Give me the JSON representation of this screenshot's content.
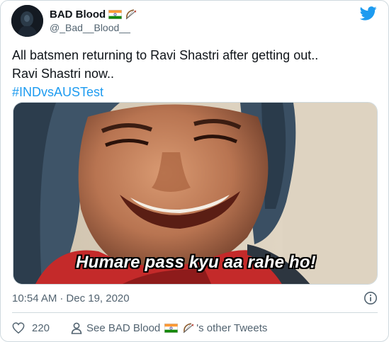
{
  "tweet": {
    "author": {
      "display_name": "BAD Blood",
      "handle": "@_Bad__Blood__",
      "name_emojis": [
        "india-flag-icon",
        "bow-and-arrow-icon"
      ]
    },
    "text_line1": "All batsmen returning to Ravi Shastri after getting out..",
    "text_line2": "Ravi Shastri now..",
    "hashtag": "#INDvsAUSTest",
    "media": {
      "caption": "Humare pass kyu aa rahe ho!"
    },
    "time": "10:54 AM",
    "separator": "·",
    "date": "Dec 19, 2020",
    "likes": "220",
    "other_tweets_prefix": "See BAD Blood",
    "other_tweets_suffix": "'s other Tweets"
  },
  "icons": {
    "brand": "twitter-bird-icon",
    "info": "info-icon",
    "like": "heart-icon",
    "profile": "person-icon"
  },
  "colors": {
    "brand_blue": "#1d9bf0",
    "text_primary": "#0f1419",
    "text_secondary": "#536471",
    "border": "#cfd9de"
  }
}
